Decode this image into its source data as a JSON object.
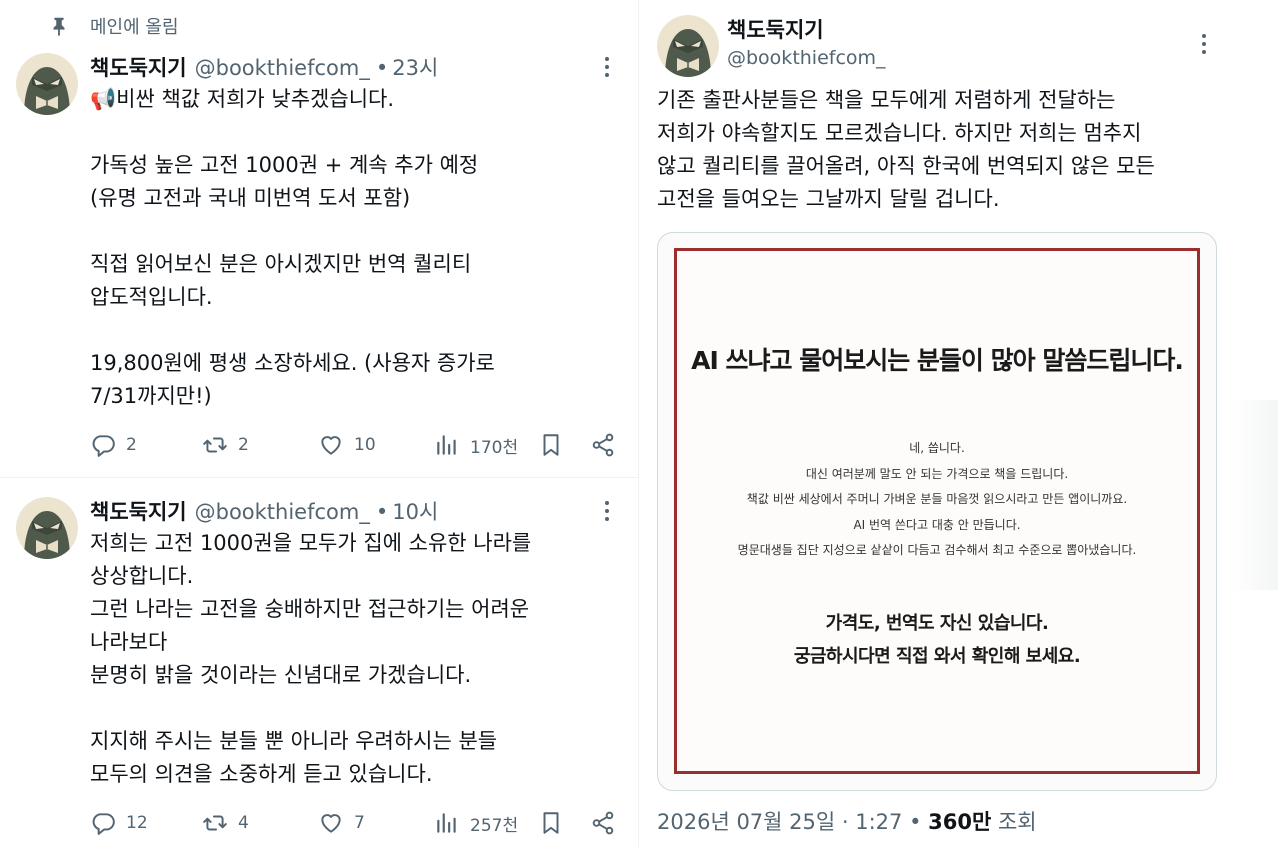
{
  "pinned_label": "메인에 올림",
  "tweets": [
    {
      "name": "책도둑지기",
      "handle": "@bookthiefcom_",
      "time": "23시",
      "body": "📢비싼 책값 저희가 낮추겠습니다.\n\n가독성 높은 고전 1000권 + 계속 추가 예정\n(유명 고전과 국내 미번역 도서 포함)\n\n직접 읽어보신 분은 아시겠지만 번역 퀄리티\n압도적입니다.\n\n19,800원에 평생 소장하세요. (사용자 증가로\n7/31까지만!)",
      "replies": "2",
      "reposts": "2",
      "likes": "10",
      "views": "170천"
    },
    {
      "name": "책도둑지기",
      "handle": "@bookthiefcom_",
      "time": "10시",
      "body": "저희는 고전 1000권을 모두가 집에 소유한 나라를\n상상합니다.\n그런 나라는 고전을 숭배하지만 접근하기는 어려운\n나라보다\n분명히 밝을 것이라는 신념대로 가겠습니다.\n\n지지해 주시는 분들 뿐 아니라 우려하시는 분들\n모두의 의견을 소중하게 듣고 있습니다.",
      "replies": "12",
      "reposts": "4",
      "likes": "7",
      "views": "257천"
    }
  ],
  "detail": {
    "name": "책도둑지기",
    "handle": "@bookthiefcom_",
    "body": "기존 출판사분들은 책을 모두에게 저렴하게 전달하는\n저희가 야속할지도 모르겠습니다. 하지만 저희는 멈추지\n않고 퀄리티를 끌어올려, 아직 한국에 번역되지 않은 모든\n고전을 들여오는 그날까지 달릴 겁니다.",
    "card": {
      "title": "AI 쓰냐고 물어보시는 분들이 많아 말씀드립니다.",
      "lines": [
        "네, 씁니다.",
        "대신 여러분께 말도 안 되는 가격으로 책을 드립니다.",
        "책값 비싼 세상에서 주머니 가벼운 분들 마음껏 읽으시라고 만든 앱이니까요.",
        "AI 번역 쓴다고 대충 안 만듭니다.",
        "명문대생들 집단 지성으로 샅샅이 다듬고 검수해서 최고 수준으로 뽑아냈습니다."
      ],
      "bottom_line1": "가격도, 번역도 자신 있습니다.",
      "bottom_line2": "궁금하시다면 직접 와서 확인해 보세요."
    },
    "date": "2026년 07월 25일 · 1:27",
    "views_count": "360만",
    "views_label": "조회"
  },
  "colors": {
    "text": "#0f1419",
    "secondary": "#536471",
    "card_border": "#9a2d2d"
  }
}
